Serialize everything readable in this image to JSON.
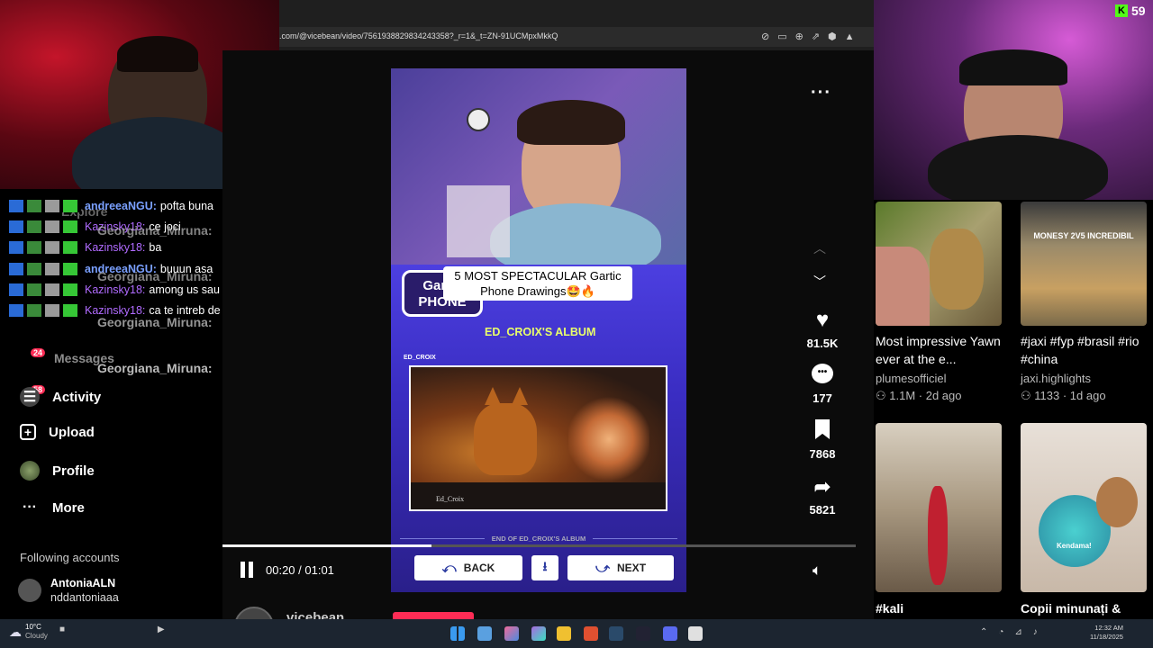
{
  "stream": {
    "follower_count": "59"
  },
  "browser": {
    "url": ".com/@vicebean/video/7561938829834243358?_r=1&_t=ZN-91UCMpxMkkQ"
  },
  "chat": [
    {
      "user": "andreeaNGU:",
      "msg": "pofta buna"
    },
    {
      "user": "Kazinsky18:",
      "msg": "ce joci"
    },
    {
      "user": "Kazinsky18:",
      "msg": "ba"
    },
    {
      "user": "andreeaNGU:",
      "msg": "buuun asa"
    },
    {
      "user": "Kazinsky18:",
      "msg": "among us sau"
    },
    {
      "user": "Kazinsky18:",
      "msg": "ca te intreb de o ora"
    },
    {
      "user": "Georgiana_Miruna:",
      "msg": ""
    },
    {
      "user": "Georgiana_Miruna:",
      "msg": ""
    },
    {
      "user": "Georgiana_Miruna:",
      "msg": ""
    },
    {
      "user": "Georgiana_Miruna:",
      "msg": ""
    }
  ],
  "sidebar": {
    "ghost_explore": "Explore",
    "messages": "Messages",
    "messages_badge": "24",
    "activity_badge": "58",
    "activity": "Activity",
    "upload": "Upload",
    "profile": "Profile",
    "more": "More",
    "following_header": "Following accounts",
    "account_name": "AntoniaALN",
    "account_handle": "nddantoniaaa"
  },
  "video": {
    "caption": "5 MOST SPECTACULAR Gartic Phone Drawings🤩🔥",
    "logo_text": "Gartic PHONE",
    "album_title": "ED_CROIX'S ALBUM",
    "drawer": "ED_CROIX",
    "signature": "Ed_Croix",
    "end_text": "END OF ED_CROIX'S ALBUM",
    "back_label": "BACK",
    "next_label": "NEXT",
    "time": "00:20 / 01:01",
    "progress": 0.33,
    "author": "vicebean"
  },
  "actions": {
    "likes": "81.5K",
    "comments": "177",
    "saves": "7868",
    "shares": "5821"
  },
  "recommendations": [
    {
      "caption": "Most impressive Yawn ever at the e...",
      "author": "plumesofficiel",
      "meta": "1.1M · 2d ago",
      "overlay": ""
    },
    {
      "caption": "#jaxi #fyp #brasil #rio #china",
      "author": "jaxi.highlights",
      "meta": "1133 · 1d ago",
      "overlay": "MONESY 2V5 INCREDIBIL"
    },
    {
      "caption": "#kali",
      "author": "",
      "meta": "",
      "overlay": ""
    },
    {
      "caption": "Copii minunați &",
      "author": "",
      "meta": "",
      "overlay": "Kendama!"
    }
  ],
  "taskbar": {
    "weather_temp": "10°C",
    "weather_desc": "Cloudy",
    "time": "12:32 AM",
    "date": "11/18/2025"
  },
  "colors": {
    "accent_red": "#fe2c55",
    "chat_name_blue": "#7aa0ff",
    "chat_name_purple": "#b06bff",
    "album_yellow": "#e9ff6a"
  }
}
